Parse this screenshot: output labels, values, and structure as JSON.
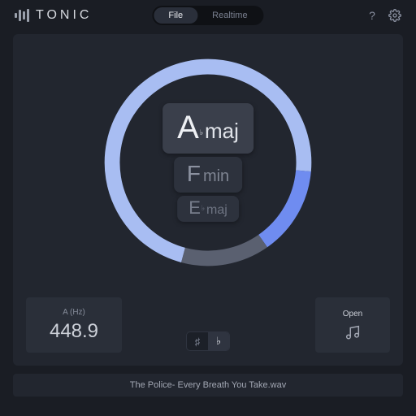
{
  "app": {
    "name": "TONIC"
  },
  "header": {
    "tabs": [
      {
        "label": "File",
        "active": true
      },
      {
        "label": "Realtime",
        "active": false
      }
    ]
  },
  "wheel": {
    "arcs": [
      {
        "start_deg": -165,
        "end_deg": 95,
        "color": "#a8bdf2"
      },
      {
        "start_deg": 95,
        "end_deg": 145,
        "color": "#6f8cf0"
      },
      {
        "start_deg": 145,
        "end_deg": 195,
        "color": "#5a6070"
      }
    ]
  },
  "results": [
    {
      "note": "A",
      "accidental": "♭",
      "quality": "maj"
    },
    {
      "note": "F",
      "accidental": "",
      "quality": "min"
    },
    {
      "note": "E",
      "accidental": "♭",
      "quality": "maj"
    }
  ],
  "tuning": {
    "label": "A (Hz)",
    "value": "448.9"
  },
  "open": {
    "label": "Open"
  },
  "accidental_toggle": {
    "sharp": "♯",
    "flat": "♭",
    "active": "flat"
  },
  "file": {
    "name": "The Police- Every Breath You Take.wav"
  }
}
